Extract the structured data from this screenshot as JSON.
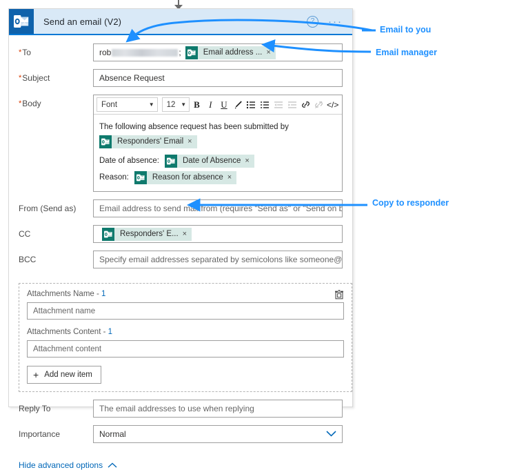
{
  "card": {
    "title": "Send an email (V2)",
    "app_icon": "outlook-icon",
    "help_icon": "?",
    "more_icon": "···"
  },
  "fields": {
    "to": {
      "label": "To",
      "required": true,
      "typed_prefix": "rob",
      "separator": ";",
      "token": {
        "label": "Email address ...",
        "remove": "×"
      }
    },
    "subject": {
      "label": "Subject",
      "required": true,
      "value": "Absence Request"
    },
    "body": {
      "label": "Body",
      "required": true,
      "toolbar": {
        "font_name": "Font",
        "font_size": "12",
        "bold": "B",
        "italic": "I",
        "underline": "U",
        "text_color": "✎",
        "bulleted_list": "≡",
        "numbered_list": "≡",
        "outdent": "≡",
        "indent": "≡",
        "link": "⚭",
        "unlink": "⚭",
        "code_view": "</>"
      },
      "content": {
        "line1": "The following absence request has been submitted by",
        "token1": {
          "label": "Responders' Email",
          "remove": "×"
        },
        "line2_prefix": "Date of absence:",
        "token2": {
          "label": "Date of Absence",
          "remove": "×"
        },
        "line3_prefix": "Reason:",
        "token3": {
          "label": "Reason for absence",
          "remove": "×"
        }
      }
    },
    "from": {
      "label": "From (Send as)",
      "placeholder": "Email address to send mail from (requires \"Send as\" or \"Send on behа"
    },
    "cc": {
      "label": "CC",
      "token": {
        "label": "Responders' E...",
        "remove": "×"
      }
    },
    "bcc": {
      "label": "BCC",
      "placeholder": "Specify email addresses separated by semicolons like someone@con"
    },
    "attachments": {
      "name_label": "Attachments Name - ",
      "name_index": "1",
      "name_placeholder": "Attachment name",
      "content_label": "Attachments Content - ",
      "content_index": "1",
      "content_placeholder": "Attachment content",
      "add_button": "Add new item",
      "delete_icon": "trash-icon"
    },
    "reply_to": {
      "label": "Reply To",
      "placeholder": "The email addresses to use when replying"
    },
    "importance": {
      "label": "Importance",
      "value": "Normal"
    }
  },
  "footer": {
    "advanced_toggle": "Hide advanced options"
  },
  "annotations": [
    {
      "id": "email-to-you",
      "text": "Email to you"
    },
    {
      "id": "email-manager",
      "text": "Email manager"
    },
    {
      "id": "copy-to-responder",
      "text": "Copy to responder"
    }
  ],
  "colors": {
    "header_bg": "#d9e9f7",
    "header_accent": "#0078d4",
    "app_icon_bg": "#0f62ab",
    "token_bg": "#d6e8e4",
    "token_icon_bg": "#0f7a6d",
    "required_star": "#d83b01",
    "link": "#0067b8",
    "annotation": "#1e90ff"
  }
}
